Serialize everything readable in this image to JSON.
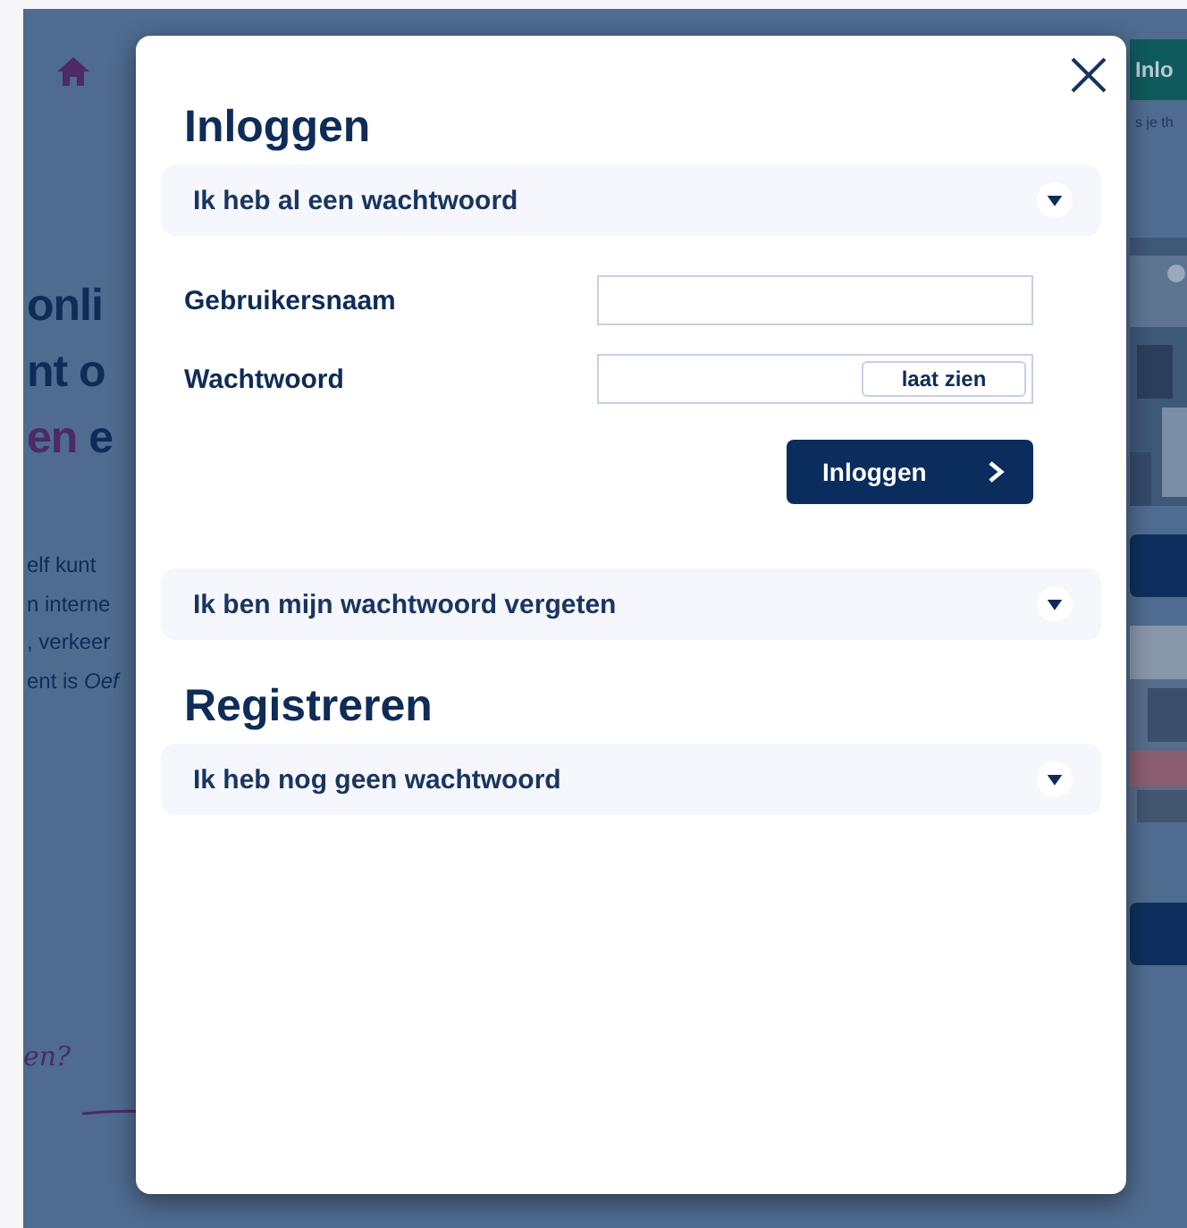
{
  "background": {
    "headline": [
      [
        {
          "text": "onli",
          "accent": false
        }
      ],
      [
        {
          "text": "nt o",
          "accent": false
        }
      ],
      [
        {
          "text": "en",
          "accent": true
        },
        {
          "text": " e",
          "accent": false
        }
      ]
    ],
    "body_lines": [
      "elf kunt",
      "n interne",
      ", verkeer",
      "ent is *Oef*"
    ],
    "handwritten_note": "en?",
    "side_button": "Inlo",
    "side_caption": "s je th"
  },
  "modal": {
    "groups": [
      {
        "title": "Inloggen",
        "panels": [
          {
            "label": "Ik heb al een wachtwoord",
            "form": {
              "fields": [
                {
                  "label": "Gebruikersnaam",
                  "kind": "text"
                },
                {
                  "label": "Wachtwoord",
                  "kind": "password",
                  "toggle": "laat zien"
                }
              ],
              "submit": "Inloggen"
            }
          },
          {
            "label": "Ik ben mijn wachtwoord vergeten"
          }
        ]
      },
      {
        "title": "Registreren",
        "panels": [
          {
            "label": "Ik heb nog geen wachtwoord"
          }
        ]
      }
    ]
  }
}
